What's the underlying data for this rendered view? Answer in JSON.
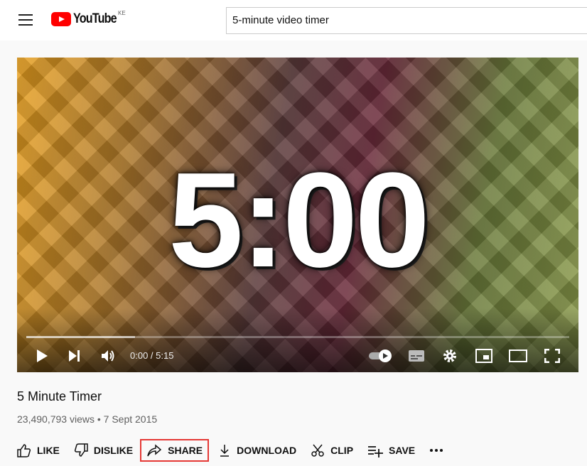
{
  "header": {
    "logo": "YouTube",
    "country_code": "KE",
    "search_value": "5-minute video timer"
  },
  "video": {
    "overlay_text": "5:00",
    "time": "0:00 / 5:15",
    "played_percent": 0,
    "buffered_percent": 20,
    "controls": [
      "play-icon",
      "next-icon",
      "volume-icon",
      "autoplay-toggle",
      "subtitles-icon",
      "settings-icon",
      "miniplayer-icon",
      "theater-icon",
      "fullscreen-icon"
    ]
  },
  "info": {
    "title": "5 Minute Timer",
    "views": "23,490,793 views",
    "date": "7 Sept 2015",
    "separator": " • "
  },
  "actions": [
    {
      "label": "LIKE"
    },
    {
      "label": "DISLIKE"
    },
    {
      "label": "SHARE",
      "highlighted": true
    },
    {
      "label": "DOWNLOAD"
    },
    {
      "label": "CLIP"
    },
    {
      "label": "SAVE"
    }
  ],
  "colors": {
    "brand": "#ff0000",
    "highlight": "#e53935"
  }
}
